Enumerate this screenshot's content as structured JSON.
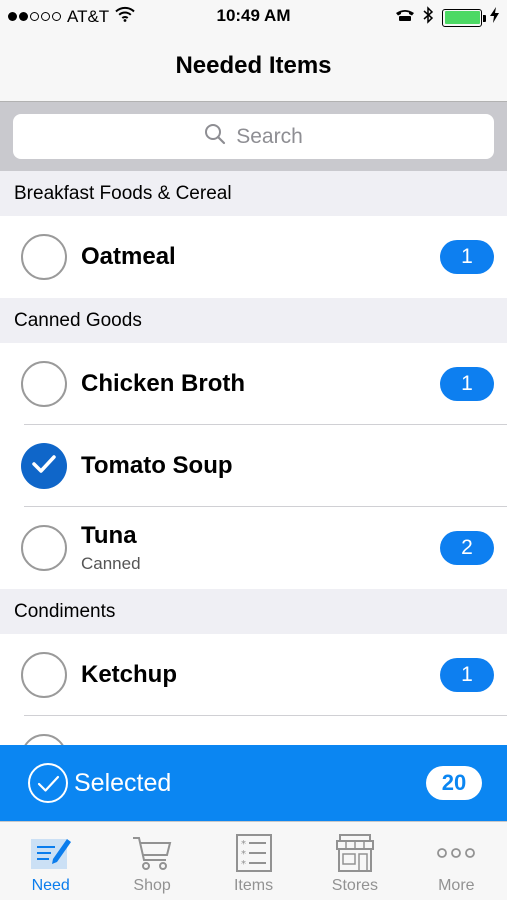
{
  "status_bar": {
    "carrier": "AT&T",
    "time": "10:49 AM",
    "signal_bars": 2,
    "battery_level": 1.0
  },
  "nav": {
    "title": "Needed Items"
  },
  "search": {
    "placeholder": "Search"
  },
  "sections": [
    {
      "title": "Breakfast Foods & Cereal",
      "items": [
        {
          "name": "Oatmeal",
          "subtitle": "",
          "count": "1",
          "checked": false
        }
      ]
    },
    {
      "title": "Canned Goods",
      "items": [
        {
          "name": "Chicken Broth",
          "subtitle": "",
          "count": "1",
          "checked": false
        },
        {
          "name": "Tomato Soup",
          "subtitle": "",
          "count": "",
          "checked": true
        },
        {
          "name": "Tuna",
          "subtitle": "Canned",
          "count": "2",
          "checked": false
        }
      ]
    },
    {
      "title": "Condiments",
      "items": [
        {
          "name": "Ketchup",
          "subtitle": "",
          "count": "1",
          "checked": false
        },
        {
          "name": "",
          "subtitle": "",
          "count": "",
          "checked": false
        }
      ]
    }
  ],
  "selected_bar": {
    "label": "Selected",
    "count": "20"
  },
  "tabs": [
    {
      "label": "Need",
      "icon": "edit-list-icon",
      "active": true
    },
    {
      "label": "Shop",
      "icon": "cart-icon",
      "active": false
    },
    {
      "label": "Items",
      "icon": "checklist-icon",
      "active": false
    },
    {
      "label": "Stores",
      "icon": "store-icon",
      "active": false
    },
    {
      "label": "More",
      "icon": "more-icon",
      "active": false
    }
  ],
  "colors": {
    "accent": "#0b86f2",
    "badge": "#0d7ff0",
    "check": "#0f66c9",
    "battery": "#4cd964"
  }
}
